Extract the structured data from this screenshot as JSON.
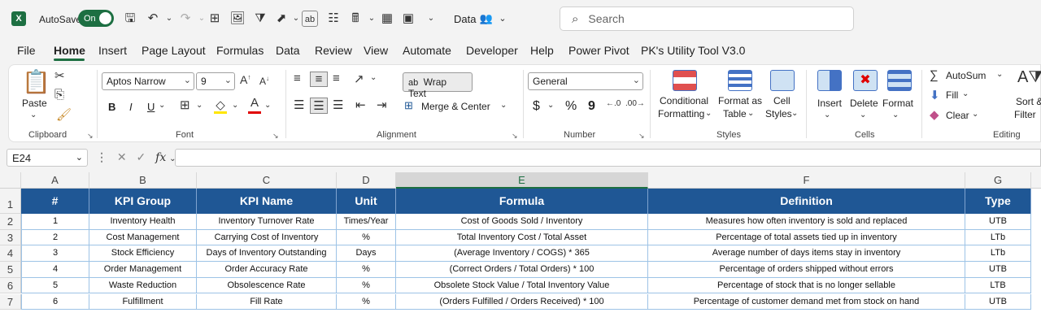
{
  "titlebar": {
    "app_logo": "X",
    "autosave_label": "AutoSave",
    "autosave_state": "On",
    "doc_title": "Data",
    "search_placeholder": "Search"
  },
  "menu": [
    "File",
    "Home",
    "Insert",
    "Page Layout",
    "Formulas",
    "Data",
    "Review",
    "View",
    "Automate",
    "Developer",
    "Help",
    "Power Pivot",
    "PK's Utility Tool V3.0"
  ],
  "ribbon": {
    "clipboard": {
      "paste": "Paste",
      "label": "Clipboard"
    },
    "font": {
      "name": "Aptos Narrow",
      "size": "9",
      "bold": "B",
      "italic": "I",
      "underline": "U",
      "label": "Font"
    },
    "alignment": {
      "wrap_text": "Wrap Text",
      "merge_center": "Merge & Center",
      "label": "Alignment"
    },
    "number": {
      "format": "General",
      "currency": "$",
      "percent": "%",
      "comma": "9",
      "label": "Number"
    },
    "styles": {
      "conditional": "Conditional",
      "formatting": "Formatting",
      "format_as": "Format as",
      "table": "Table",
      "cell": "Cell",
      "cell_styles": "Styles",
      "label": "Styles"
    },
    "cells": {
      "insert": "Insert",
      "delete": "Delete",
      "format": "Format",
      "label": "Cells"
    },
    "editing": {
      "autosum": "AutoSum",
      "fill": "Fill",
      "clear": "Clear",
      "sort": "Sort &",
      "filter": "Filter",
      "label": "Editing"
    }
  },
  "formula_bar": {
    "name_box": "E24",
    "fx": "fx",
    "content": ""
  },
  "columns": [
    "A",
    "B",
    "C",
    "D",
    "E",
    "F",
    "G"
  ],
  "selected_column": "E",
  "row_numbers": [
    "1",
    "2",
    "3",
    "4",
    "5",
    "6",
    "7"
  ],
  "table": {
    "headers": [
      "#",
      "KPI Group",
      "KPI Name",
      "Unit",
      "Formula",
      "Definition",
      "Type"
    ],
    "rows": [
      [
        "1",
        "Inventory Health",
        "Inventory Turnover Rate",
        "Times/Year",
        "Cost of Goods Sold / Inventory",
        "Measures how often inventory is sold and replaced",
        "UTB"
      ],
      [
        "2",
        "Cost Management",
        "Carrying Cost of Inventory",
        "%",
        "Total Inventory Cost / Total Asset",
        "Percentage of total assets tied up in inventory",
        "LTb"
      ],
      [
        "3",
        "Stock Efficiency",
        "Days of Inventory Outstanding",
        "Days",
        "(Average Inventory / COGS) * 365",
        "Average number of days items stay in inventory",
        "LTb"
      ],
      [
        "4",
        "Order Management",
        "Order Accuracy Rate",
        "%",
        "(Correct Orders / Total Orders) * 100",
        "Percentage of orders shipped without errors",
        "UTB"
      ],
      [
        "5",
        "Waste Reduction",
        "Obsolescence Rate",
        "%",
        "Obsolete Stock Value / Total Inventory Value",
        "Percentage of stock that is no longer sellable",
        "LTB"
      ],
      [
        "6",
        "Fulfillment",
        "Fill Rate",
        "%",
        "(Orders Fulfilled / Orders Received) * 100",
        "Percentage of customer demand met from stock on hand",
        "UTB"
      ]
    ]
  },
  "colors": {
    "excel_green": "#1d6f42",
    "header_blue": "#1f5795",
    "grid_blue": "#9dc3e6"
  }
}
